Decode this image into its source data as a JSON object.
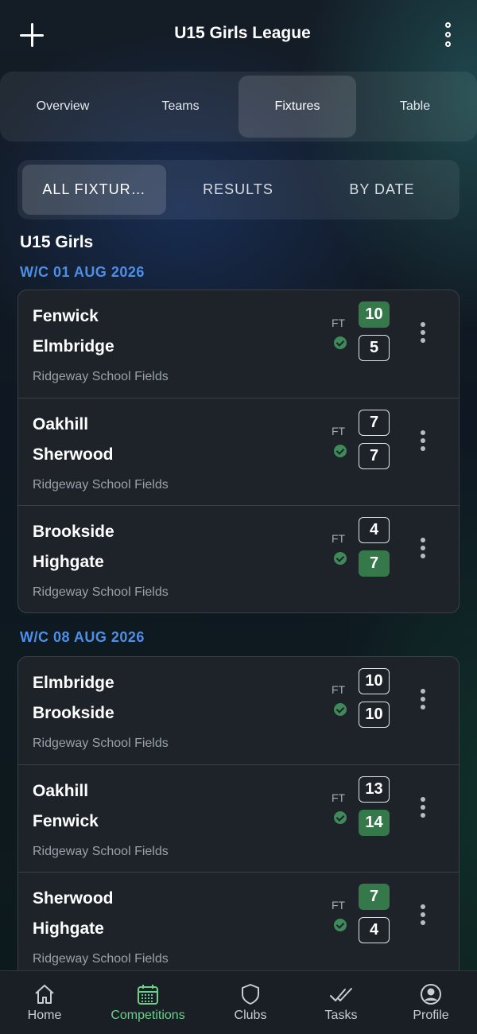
{
  "header": {
    "title": "U15 Girls League",
    "add_icon": "plus-icon",
    "more_icon": "more-vertical-icon"
  },
  "tabs": [
    {
      "label": "Overview",
      "active": false
    },
    {
      "label": "Teams",
      "active": false
    },
    {
      "label": "Fixtures",
      "active": true
    },
    {
      "label": "Table",
      "active": false
    }
  ],
  "filters": [
    {
      "label": "ALL FIXTUR…",
      "active": true
    },
    {
      "label": "RESULTS",
      "active": false
    },
    {
      "label": "BY DATE",
      "active": false
    }
  ],
  "competition": "U15 Girls",
  "weeks": [
    {
      "label": "W/C 01 AUG 2026",
      "fixtures": [
        {
          "home": "Fenwick",
          "away": "Elmbridge",
          "home_score": "10",
          "away_score": "5",
          "winner": "home",
          "status": "FT",
          "venue": "Ridgeway School Fields"
        },
        {
          "home": "Oakhill",
          "away": "Sherwood",
          "home_score": "7",
          "away_score": "7",
          "winner": "draw",
          "status": "FT",
          "venue": "Ridgeway School Fields"
        },
        {
          "home": "Brookside",
          "away": "Highgate",
          "home_score": "4",
          "away_score": "7",
          "winner": "away",
          "status": "FT",
          "venue": "Ridgeway School Fields"
        }
      ]
    },
    {
      "label": "W/C 08 AUG 2026",
      "fixtures": [
        {
          "home": "Elmbridge",
          "away": "Brookside",
          "home_score": "10",
          "away_score": "10",
          "winner": "draw",
          "status": "FT",
          "venue": "Ridgeway School Fields"
        },
        {
          "home": "Oakhill",
          "away": "Fenwick",
          "home_score": "13",
          "away_score": "14",
          "winner": "away",
          "status": "FT",
          "venue": "Ridgeway School Fields"
        },
        {
          "home": "Sherwood",
          "away": "Highgate",
          "home_score": "7",
          "away_score": "4",
          "winner": "home",
          "status": "FT",
          "venue": "Ridgeway School Fields"
        }
      ]
    }
  ],
  "bottom_nav": [
    {
      "label": "Home",
      "icon": "home-icon",
      "active": false
    },
    {
      "label": "Competitions",
      "icon": "calendar-icon",
      "active": true
    },
    {
      "label": "Clubs",
      "icon": "shield-icon",
      "active": false
    },
    {
      "label": "Tasks",
      "icon": "double-check-icon",
      "active": false
    },
    {
      "label": "Profile",
      "icon": "user-circle-icon",
      "active": false
    }
  ],
  "colors": {
    "accent_blue": "#4d8fe8",
    "win_green": "#35784a",
    "nav_active": "#6bd08a"
  }
}
